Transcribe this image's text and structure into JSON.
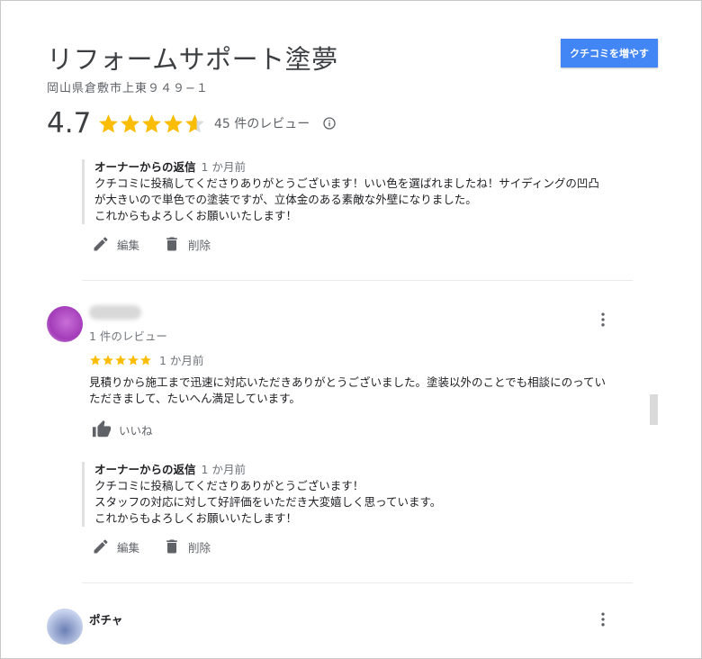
{
  "place": {
    "title": "リフォームサポート塗夢",
    "address": "岡山県倉敷市上東９４９−１",
    "rating": "4.7",
    "review_count": "45 件のレビュー"
  },
  "cta_label": "クチコミを増やす",
  "reviews": [
    {
      "owner_reply": {
        "label": "オーナーからの返信",
        "time": "1 か月前",
        "lines": [
          "クチコミに投稿してくださりありがとうございます！いい色を選ばれましたね！サイディングの凹凸",
          "が大きいので単色での塗装ですが、立体金のある素敵な外壁になりました。",
          "これからもよろしくお願いいたします！"
        ]
      },
      "actions": {
        "edit": "編集",
        "delete": "削除"
      }
    },
    {
      "reviewer_meta": "1 件のレビュー",
      "stars": 5,
      "time": "1 か月前",
      "text_lines": [
        "見積りから施工まで迅速に対応いただきありがとうございました。塗装以外のことでも相談にのってい",
        "ただきまして、たいへん満足しています。"
      ],
      "like_label": "いいね",
      "owner_reply": {
        "label": "オーナーからの返信",
        "time": "1 か月前",
        "lines": [
          "クチコミに投稿してくださりありがとうございます！",
          "スタッフの対応に対して好評価をいただき大変嬉しく思っています。",
          "これからもよろしくお願いいたします！"
        ]
      },
      "actions": {
        "edit": "編集",
        "delete": "削除"
      }
    },
    {
      "reviewer_name": "ポチャ"
    }
  ],
  "colors": {
    "star": "#fbbc04",
    "accent": "#4285f4",
    "avatar1": "#b04ec4"
  },
  "icons": [
    "star-icon",
    "info-icon",
    "edit-icon",
    "delete-icon",
    "thumb-up-icon",
    "more-vert-icon"
  ]
}
